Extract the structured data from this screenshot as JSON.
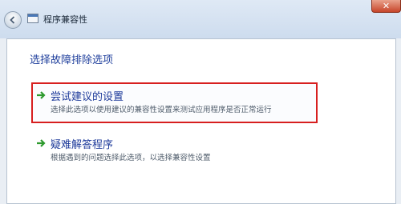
{
  "window": {
    "title": "程序兼容性",
    "back_icon": "back-arrow-icon",
    "app_icon": "program-window-icon",
    "close_label": "✕"
  },
  "main": {
    "heading": "选择故障排除选项",
    "options": [
      {
        "icon": "green-arrow-icon",
        "title": "尝试建议的设置",
        "description": "选择此选项以使用建议的兼容性设置来测试应用程序是否正常运行"
      },
      {
        "icon": "green-arrow-icon",
        "title": "疑难解答程序",
        "description": "根据遇到的问题选择此选项，以选择兼容性设置"
      }
    ]
  },
  "colors": {
    "highlight_border": "#d71f1f",
    "link_blue": "#1d3a9a",
    "arrow_green": "#2e9a2e"
  }
}
